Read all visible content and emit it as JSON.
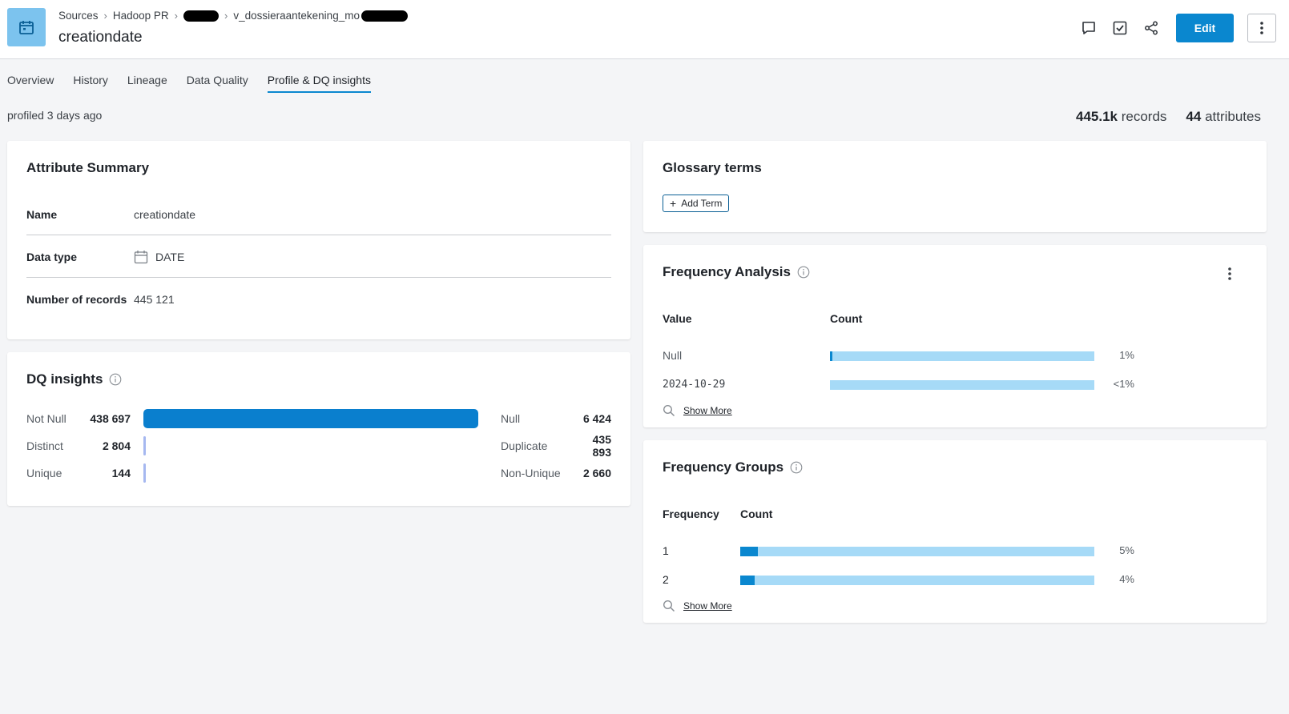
{
  "header": {
    "breadcrumb": [
      "Sources",
      "Hadoop PR",
      "v_dossieraantekening_mo"
    ],
    "title": "creationdate",
    "edit_label": "Edit",
    "icons": [
      "calendar-icon",
      "comment-icon",
      "task-check-icon",
      "share-icon",
      "more-vertical-icon"
    ]
  },
  "tabs": [
    "Overview",
    "History",
    "Lineage",
    "Data Quality",
    "Profile & DQ insights"
  ],
  "active_tab": "Profile & DQ insights",
  "profiled": "profiled 3 days ago",
  "stats": {
    "records_value": "445.1k",
    "records_label": "records",
    "attributes_value": "44",
    "attributes_label": "attributes"
  },
  "attribute_summary": {
    "title": "Attribute Summary",
    "rows": [
      {
        "label": "Name",
        "value": "creationdate"
      },
      {
        "label": "Data type",
        "value": "DATE"
      },
      {
        "label": "Number of records",
        "value": "445 121"
      }
    ]
  },
  "dq_insights": {
    "title": "DQ insights",
    "rows": [
      {
        "label": "Not Null",
        "value": "438 697",
        "fraction": 0.986,
        "color": "#0a7fce",
        "label2": "Null",
        "value2": "6 424"
      },
      {
        "label": "Distinct",
        "value": "2 804",
        "fraction": 0.006,
        "color": "#a6b8f0",
        "label2": "Duplicate",
        "value2": "435 893"
      },
      {
        "label": "Unique",
        "value": "144",
        "fraction": 0.003,
        "color": "#a6b8f0",
        "label2": "Non-Unique",
        "value2": "2 660"
      }
    ]
  },
  "glossary": {
    "title": "Glossary terms",
    "add_term_label": "Add Term"
  },
  "frequency_analysis": {
    "title": "Frequency Analysis",
    "col_value": "Value",
    "col_count": "Count",
    "rows": [
      {
        "value": "Null",
        "pct": "1%",
        "fraction": 0.01
      },
      {
        "value": "2024-10-29",
        "pct": "<1%",
        "fraction": 0.0
      }
    ],
    "show_more": "Show More"
  },
  "frequency_groups": {
    "title": "Frequency Groups",
    "col_frequency": "Frequency",
    "col_count": "Count",
    "rows": [
      {
        "value": "1",
        "pct": "5%",
        "fraction": 0.05
      },
      {
        "value": "2",
        "pct": "4%",
        "fraction": 0.04
      }
    ],
    "show_more": "Show More"
  },
  "colors": {
    "accent": "#0a87cf",
    "bar_light": "#a6daf7",
    "bar_dark": "#0a87cf",
    "icon_bg": "#7cc3ee"
  }
}
